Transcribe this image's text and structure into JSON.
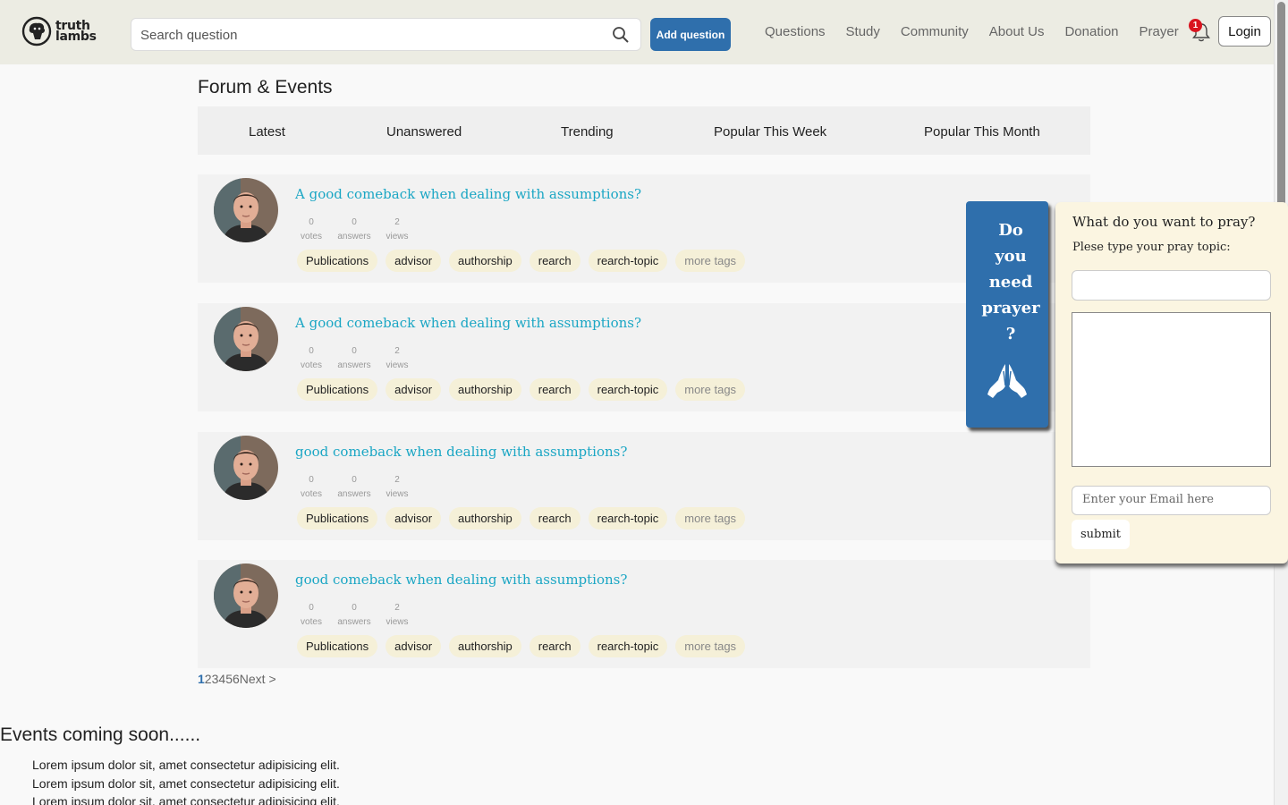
{
  "header": {
    "logo_line1": "truth",
    "logo_line2": "lambs",
    "search_placeholder": "Search question",
    "add_question_label": "Add question",
    "nav": [
      "Questions",
      "Study",
      "Community",
      "About Us",
      "Donation",
      "Prayer"
    ],
    "notification_count": "1",
    "login_label": "Login"
  },
  "main": {
    "title": "Forum & Events",
    "tabs": [
      "Latest",
      "Unanswered",
      "Trending",
      "Popular This Week",
      "Popular This Month"
    ],
    "questions": [
      {
        "title": "A good comeback when dealing with assumptions?",
        "votes": "0",
        "votes_label": "votes",
        "answers": "0",
        "answers_label": "answers",
        "views": "2",
        "views_label": "views"
      },
      {
        "title": "A good comeback when dealing with assumptions?",
        "votes": "0",
        "votes_label": "votes",
        "answers": "0",
        "answers_label": "answers",
        "views": "2",
        "views_label": "views"
      },
      {
        "title": "good comeback when dealing with assumptions?",
        "votes": "0",
        "votes_label": "votes",
        "answers": "0",
        "answers_label": "answers",
        "views": "2",
        "views_label": "views"
      },
      {
        "title": "good comeback when dealing with assumptions?",
        "votes": "0",
        "votes_label": "votes",
        "answers": "0",
        "answers_label": "answers",
        "views": "2",
        "views_label": "views"
      }
    ],
    "tags": [
      "Publications",
      "advisor",
      "authorship",
      "rearch",
      "rearch-topic"
    ],
    "more_tags_label": "more tags",
    "pagination": {
      "pages": [
        "1",
        "2",
        "3",
        "4",
        "5",
        "6"
      ],
      "next_label": "Next >",
      "current": "1"
    }
  },
  "events": {
    "title": "Events coming soon......",
    "items": [
      "Lorem ipsum dolor sit, amet consectetur adipisicing elit.",
      "Lorem ipsum dolor sit, amet consectetur adipisicing elit.",
      "Lorem ipsum dolor sit, amet consectetur adipisicing elit."
    ]
  },
  "prayer": {
    "tab_lines": [
      "Do",
      "you",
      "need",
      "prayer",
      "?"
    ],
    "title": "What do you want to pray?",
    "subtitle": "Plese type your pray topic:",
    "email_placeholder": "Enter your Email here",
    "submit_label": "submit"
  },
  "colors": {
    "accent": "#2f6fac",
    "question_link": "#1aa6c4",
    "tag_bg": "#f5f0d8",
    "header_bg": "#ecece3",
    "panel_bg": "#fbf5e1",
    "badge": "#d9141f"
  },
  "icons": [
    "search-icon",
    "bell-icon",
    "praying-hands-icon",
    "lamb-logo-icon"
  ]
}
